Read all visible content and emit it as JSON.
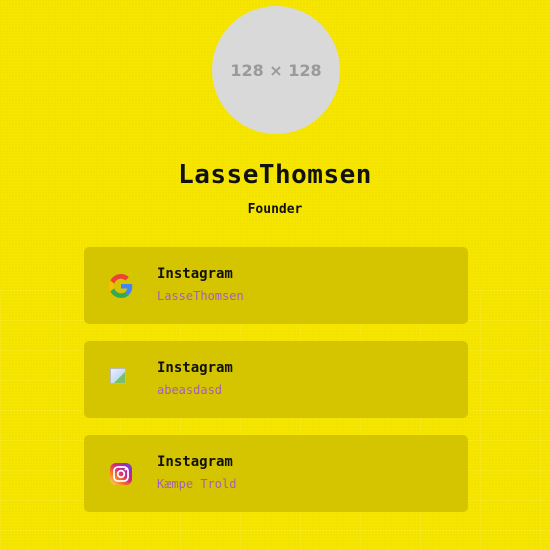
{
  "profile": {
    "avatar_placeholder": "128 × 128",
    "name": "LasseThomsen",
    "role": "Founder"
  },
  "links": [
    {
      "title": "Instagram",
      "subtitle": "LasseThomsen",
      "icon": "google-icon"
    },
    {
      "title": "Instagram",
      "subtitle": "abeasdasd",
      "icon": "broken-image-icon"
    },
    {
      "title": "Instagram",
      "subtitle": "Kæmpe Trold",
      "icon": "instagram-icon"
    }
  ],
  "colors": {
    "background": "#f7e600",
    "card": "#d4c500",
    "subtitle": "#a05fc0",
    "text": "#111111"
  }
}
